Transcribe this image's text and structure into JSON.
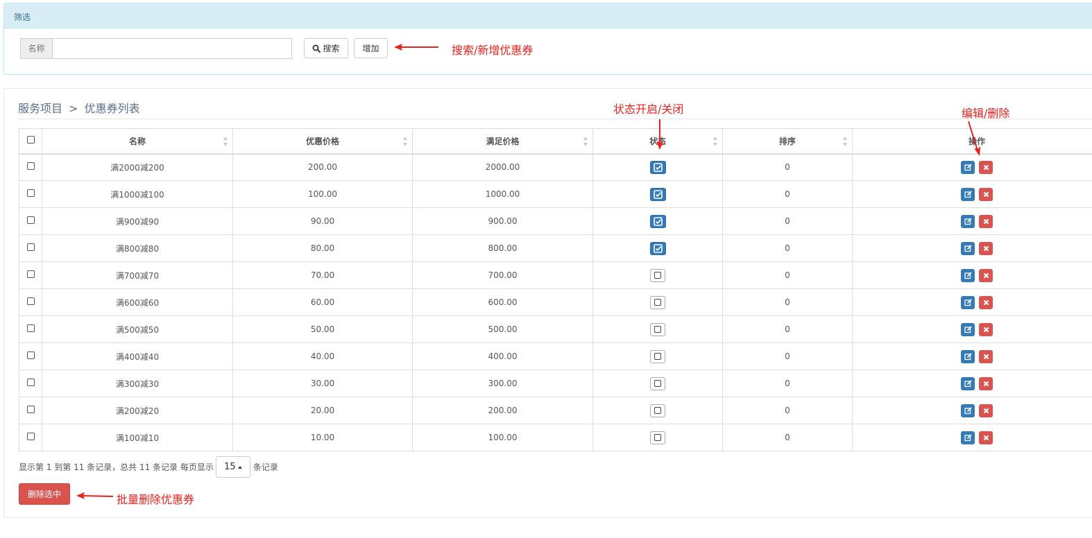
{
  "filter": {
    "title": "筛选",
    "name_label": "名称",
    "name_value": "",
    "name_placeholder": "",
    "search_label": "搜索",
    "add_label": "增加"
  },
  "breadcrumb": {
    "root": "服务项目",
    "separator": ">",
    "current": "优惠券列表"
  },
  "table": {
    "columns": [
      "名称",
      "优惠价格",
      "满足价格",
      "状态",
      "排序",
      "操作"
    ],
    "rows": [
      {
        "name": "满2000减200",
        "discount": "200.00",
        "threshold": "2000.00",
        "enabled": true,
        "sort": "0"
      },
      {
        "name": "满1000减100",
        "discount": "100.00",
        "threshold": "1000.00",
        "enabled": true,
        "sort": "0"
      },
      {
        "name": "满900减90",
        "discount": "90.00",
        "threshold": "900.00",
        "enabled": true,
        "sort": "0"
      },
      {
        "name": "满800减80",
        "discount": "80.00",
        "threshold": "800.00",
        "enabled": true,
        "sort": "0"
      },
      {
        "name": "满700减70",
        "discount": "70.00",
        "threshold": "700.00",
        "enabled": false,
        "sort": "0"
      },
      {
        "name": "满600减60",
        "discount": "60.00",
        "threshold": "600.00",
        "enabled": false,
        "sort": "0"
      },
      {
        "name": "满500减50",
        "discount": "50.00",
        "threshold": "500.00",
        "enabled": false,
        "sort": "0"
      },
      {
        "name": "满400减40",
        "discount": "40.00",
        "threshold": "400.00",
        "enabled": false,
        "sort": "0"
      },
      {
        "name": "满300减30",
        "discount": "30.00",
        "threshold": "300.00",
        "enabled": false,
        "sort": "0"
      },
      {
        "name": "满200减20",
        "discount": "20.00",
        "threshold": "200.00",
        "enabled": false,
        "sort": "0"
      },
      {
        "name": "满100减10",
        "discount": "10.00",
        "threshold": "100.00",
        "enabled": false,
        "sort": "0"
      }
    ]
  },
  "pager": {
    "summary": "显示第 1 到第 11 条记录，总共 11 条记录 每页显示",
    "page_size": "15",
    "suffix": "条记录"
  },
  "bulk_delete_label": "删除选中",
  "annotations": {
    "search_add": "搜索/新增优惠券",
    "status_toggle": "状态开启/关闭",
    "edit_delete": "编辑/删除",
    "bulk_delete": "批量删除优惠券"
  },
  "colors": {
    "primary": "#337ab7",
    "danger": "#d9534f",
    "annotation": "#e8211d",
    "filter_header_bg": "#d9edf7"
  },
  "icons": {
    "search": "search-icon",
    "status_on": "check-square-icon",
    "status_off": "square-icon",
    "edit": "edit-icon",
    "delete": "close-icon",
    "arrow": "arrow-annotation-icon"
  }
}
